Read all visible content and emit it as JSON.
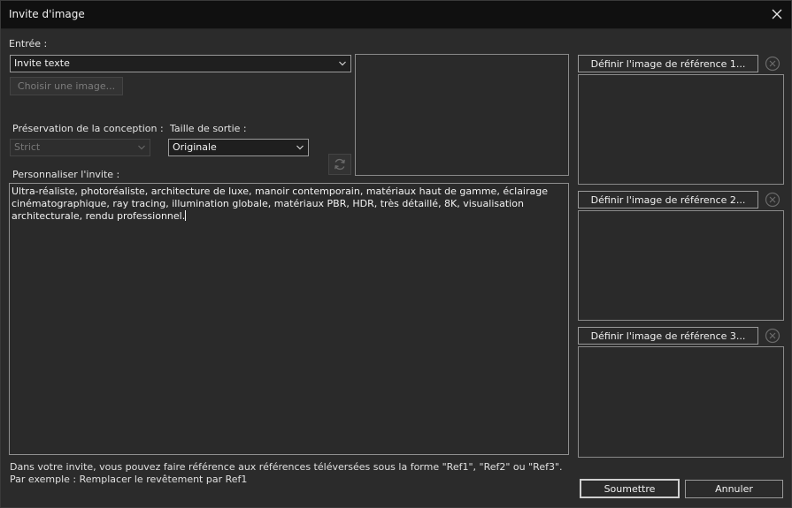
{
  "window": {
    "title": "Invite d'image",
    "close_icon": "close-icon"
  },
  "input": {
    "label": "Entrée :",
    "selected": "Invite texte",
    "choose_image_label": "Choisir une image..."
  },
  "design_preservation": {
    "label": "Préservation de la conception :",
    "selected": "Strict"
  },
  "output_size": {
    "label": "Taille de sortie :",
    "selected": "Originale"
  },
  "prompt": {
    "label": "Personnaliser l'invite :",
    "text": "Ultra-réaliste, photoréaliste, architecture de luxe, manoir contemporain, matériaux haut de gamme, éclairage cinématographique, ray tracing, illumination globale, matériaux PBR, HDR, très détaillé, 8K, visualisation architecturale, rendu professionnel."
  },
  "references": [
    {
      "button_label": "Définir l'image de référence 1..."
    },
    {
      "button_label": "Définir l'image de référence 2..."
    },
    {
      "button_label": "Définir l'image de référence 3..."
    }
  ],
  "hint": {
    "line1": "Dans votre invite, vous pouvez faire référence aux références téléversées sous la forme \"Ref1\", \"Ref2\" ou \"Ref3\".",
    "line2": "Par exemple : Remplacer le revêtement par Ref1"
  },
  "actions": {
    "submit_label": "Soumettre",
    "cancel_label": "Annuler"
  },
  "colors": {
    "background": "#2b2b2b",
    "titlebar": "#101010",
    "field": "#1f1f1f",
    "border": "#9a9a9a"
  }
}
